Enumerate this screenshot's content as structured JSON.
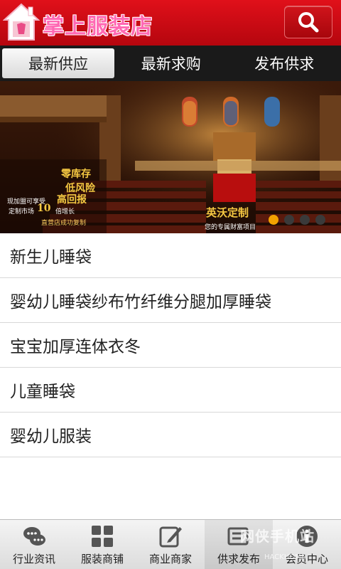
{
  "header": {
    "title": "掌上服装店",
    "logo_icon": "house-logo-icon",
    "search_icon": "search-icon",
    "brand_color": "#d10b14"
  },
  "tabs": [
    {
      "label": "最新供应",
      "active": true
    },
    {
      "label": "最新求购",
      "active": false
    },
    {
      "label": "发布供求",
      "active": false
    }
  ],
  "banner": {
    "line1": "零库存",
    "line2": "低风险",
    "line3a": "现加盟可享受",
    "line3b": "高回报",
    "line4a": "定制市场",
    "line4b": "10",
    "line4c": "倍增长",
    "line5": "直营店成功复制",
    "brand": "英沃定制",
    "slogan": "您的专属财富项目",
    "slide_count": 4,
    "active_slide": 1
  },
  "list": [
    {
      "label": "新生儿睡袋"
    },
    {
      "label": "婴幼儿睡袋纱布竹纤维分腿加厚睡袋"
    },
    {
      "label": "宝宝加厚连体衣冬"
    },
    {
      "label": "儿童睡袋"
    },
    {
      "label": "婴幼儿服装"
    }
  ],
  "bottom_nav": [
    {
      "label": "行业资讯",
      "icon": "chat-bubbles-icon",
      "active": false
    },
    {
      "label": "服装商铺",
      "icon": "grid-icon",
      "active": false
    },
    {
      "label": "商业商家",
      "icon": "edit-icon",
      "active": false
    },
    {
      "label": "供求发布",
      "icon": "publish-icon",
      "active": true
    },
    {
      "label": "会员中心",
      "icon": "info-icon",
      "active": false
    }
  ],
  "watermark": {
    "main": "网侠手机站",
    "sub": "HACKHOME"
  }
}
